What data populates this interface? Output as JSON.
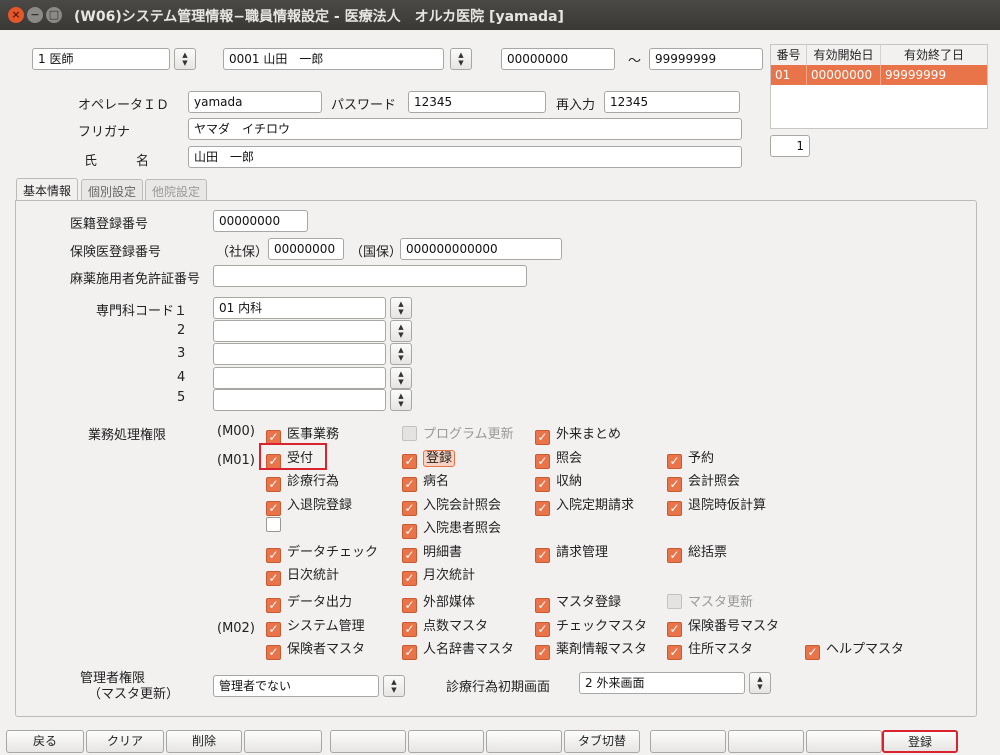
{
  "window": {
    "title": "(W06)システム管理情報−職員情報設定 - 医療法人　オルカ医院 [yamada]"
  },
  "top": {
    "job": "1 医師",
    "staff": "0001 山田　一郎",
    "range_from": "00000000",
    "tilde": "〜",
    "range_to": "99999999",
    "operator_id_label": "オペレータＩＤ",
    "operator_id": "yamada",
    "password_label": "パスワード",
    "password": "12345",
    "reinput_label": "再入力",
    "reinput": "12345",
    "furigana_label": "フリガナ",
    "furigana": "ヤマダ　イチロウ",
    "name_label": "氏　　　名",
    "name": "山田　一郎",
    "count": "1"
  },
  "validity_table": {
    "headers": [
      "番号",
      "有効開始日",
      "有効終了日"
    ],
    "rows": [
      [
        "01",
        "00000000",
        "99999999"
      ]
    ]
  },
  "tabs": [
    {
      "label": "基本情報"
    },
    {
      "label": "個別設定"
    },
    {
      "label": "他院設定"
    }
  ],
  "basic": {
    "reg_no_label": "医籍登録番号",
    "reg_no": "00000000",
    "insurance_label": "保険医登録番号",
    "shaho_label": "（社保）",
    "shaho": "00000000",
    "kokuho_label": "（国保）",
    "kokuho": "000000000000",
    "narcotic_label": "麻薬施用者免許証番号",
    "narcotic": "",
    "dept_label": "専門科コード１",
    "dept_nums": [
      "2",
      "3",
      "4",
      "5"
    ],
    "depts": [
      "01 内科",
      "",
      "",
      "",
      ""
    ],
    "perm_label": "業務処理権限",
    "group_m00": "(M00)",
    "group_m01": "(M01)",
    "group_m02": "(M02)",
    "perms": {
      "p1": "医事業務",
      "p2": "プログラム更新",
      "p3": "外来まとめ",
      "p4": "受付",
      "p5": "登録",
      "p6": "照会",
      "p7": "予約",
      "p8": "診療行為",
      "p9": "病名",
      "p10": "収納",
      "p11": "会計照会",
      "p12": "入退院登録",
      "p13": "入院会計照会",
      "p14": "入院定期請求",
      "p15": "退院時仮計算",
      "p16": "入院患者照会",
      "p17": "データチェック",
      "p18": "明細書",
      "p19": "請求管理",
      "p20": "総括票",
      "p21": "日次統計",
      "p22": "月次統計",
      "p23": "データ出力",
      "p24": "外部媒体",
      "p25": "マスタ登録",
      "p26": "マスタ更新",
      "p27": "システム管理",
      "p28": "点数マスタ",
      "p29": "チェックマスタ",
      "p30": "保険番号マスタ",
      "p31": "保険者マスタ",
      "p32": "人名辞書マスタ",
      "p33": "薬剤情報マスタ",
      "p34": "住所マスタ",
      "p35": "ヘルプマスタ"
    },
    "admin_label1": "管理者権限",
    "admin_label2": "（マスタ更新）",
    "admin_value": "管理者でない",
    "initial_screen_label": "診療行為初期画面",
    "initial_screen_value": "2 外来画面"
  },
  "footer": {
    "back": "戻る",
    "clear": "クリア",
    "delete": "削除",
    "tab_switch": "タブ切替",
    "register": "登録"
  },
  "colors": {
    "accent": "#e9744a",
    "highlight_border": "#d9232e"
  }
}
